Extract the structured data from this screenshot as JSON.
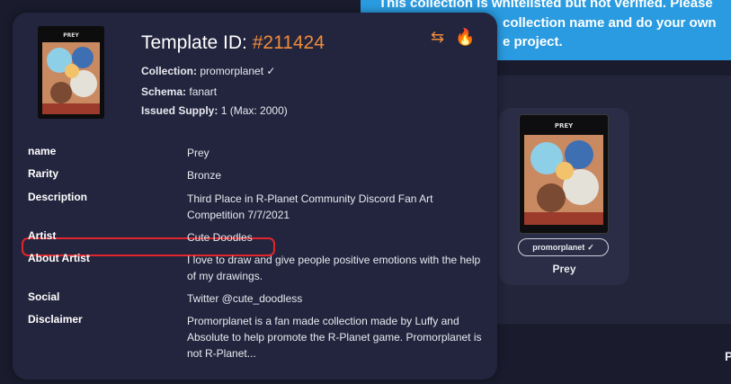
{
  "banner": {
    "line1": "This collection is whitelisted but not verified. Please",
    "line2": "collection name and do your own",
    "line3": "e project."
  },
  "card": {
    "collection": "promorplanet",
    "verified_mark": "✓",
    "name": "Prey",
    "image_label": "PREY"
  },
  "bottom_fragment": "P",
  "popup": {
    "title_prefix": "Template ID: ",
    "template_id": "#211424",
    "collection_label": "Collection:",
    "collection_value": "promorplanet",
    "verified_mark": "✓",
    "schema_label": "Schema:",
    "schema_value": "fanart",
    "supply_label": "Issued Supply:",
    "supply_value": "1 (Max: 2000)",
    "thumb_label": "PREY",
    "icons": {
      "transfer": "⇆",
      "burn": "🔥"
    },
    "attributes": [
      {
        "key": "name",
        "value": "Prey"
      },
      {
        "key": "Rarity",
        "value": "Bronze"
      },
      {
        "key": "Description",
        "value": "Third Place in R-Planet Community Discord Fan Art Competition 7/7/2021"
      },
      {
        "key": "Artist",
        "value": "Cute Doodles"
      },
      {
        "key": "About Artist",
        "value": "I love to draw and give people positive emotions with the help of my drawings."
      },
      {
        "key": "Social",
        "value": "Twitter @cute_doodless"
      },
      {
        "key": "Disclaimer",
        "value": "Promorplanet is a fan made collection made by Luffy and Absolute to help promote the R-Planet game. Promorplanet is not R-Planet..."
      }
    ]
  },
  "colors": {
    "accent_orange": "#f08c3a",
    "highlight_red": "#e0262b",
    "banner_blue": "#2a9be0"
  }
}
